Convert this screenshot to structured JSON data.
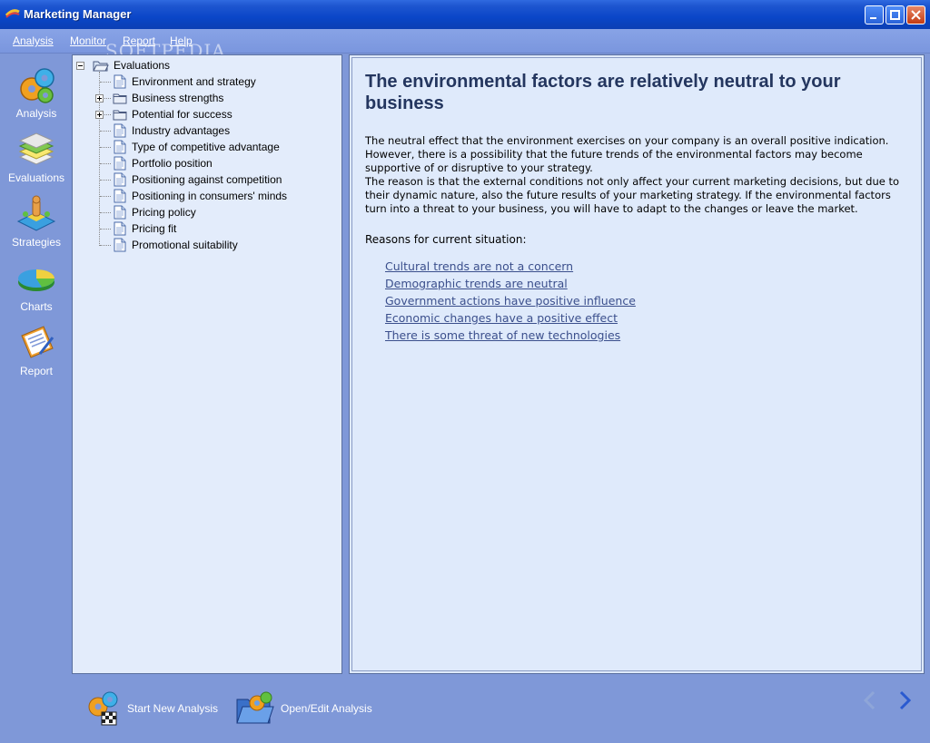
{
  "window": {
    "title": "Marketing Manager",
    "watermark": "SOFTPEDIA"
  },
  "menu": {
    "items": [
      "Analysis",
      "Monitor",
      "Report",
      "Help"
    ]
  },
  "sidebar": {
    "items": [
      {
        "label": "Analysis",
        "icon": "gears-icon"
      },
      {
        "label": "Evaluations",
        "icon": "layers-icon"
      },
      {
        "label": "Strategies",
        "icon": "chess-icon"
      },
      {
        "label": "Charts",
        "icon": "pie-chart-icon"
      },
      {
        "label": "Report",
        "icon": "clipboard-icon"
      }
    ]
  },
  "tree": {
    "root": "Evaluations",
    "items": [
      {
        "label": "Environment and strategy",
        "type": "document"
      },
      {
        "label": "Business strengths",
        "type": "folder"
      },
      {
        "label": "Potential for success",
        "type": "folder"
      },
      {
        "label": "Industry advantages",
        "type": "document"
      },
      {
        "label": "Type of competitive advantage",
        "type": "document"
      },
      {
        "label": "Portfolio position",
        "type": "document"
      },
      {
        "label": "Positioning against competition",
        "type": "document"
      },
      {
        "label": "Positioning in consumers' minds",
        "type": "document"
      },
      {
        "label": "Pricing policy",
        "type": "document"
      },
      {
        "label": "Pricing fit",
        "type": "document"
      },
      {
        "label": "Promotional suitability",
        "type": "document"
      }
    ]
  },
  "content": {
    "heading": " The environmental factors are relatively neutral to your business",
    "paragraph1": "The neutral effect that the environment exercises on your company is an overall positive indication. However, there is a possibility that the future trends of the environmental factors may become supportive of or disruptive to your strategy.",
    "paragraph2": "The reason is that the external conditions not only affect your current marketing decisions, but due to their dynamic nature, also the future results of your marketing strategy. If the environmental factors turn into a threat to your business, you will have to adapt to the changes or leave the market.",
    "reasons_label": "Reasons for current situation:",
    "reasons": [
      "Cultural trends are not a concern",
      "Demographic trends are neutral",
      "Government actions have positive influence",
      "Economic changes have a positive effect",
      "There is some threat of new technologies"
    ]
  },
  "bottom": {
    "start_new": "Start New Analysis",
    "open_edit": "Open/Edit Analysis"
  }
}
